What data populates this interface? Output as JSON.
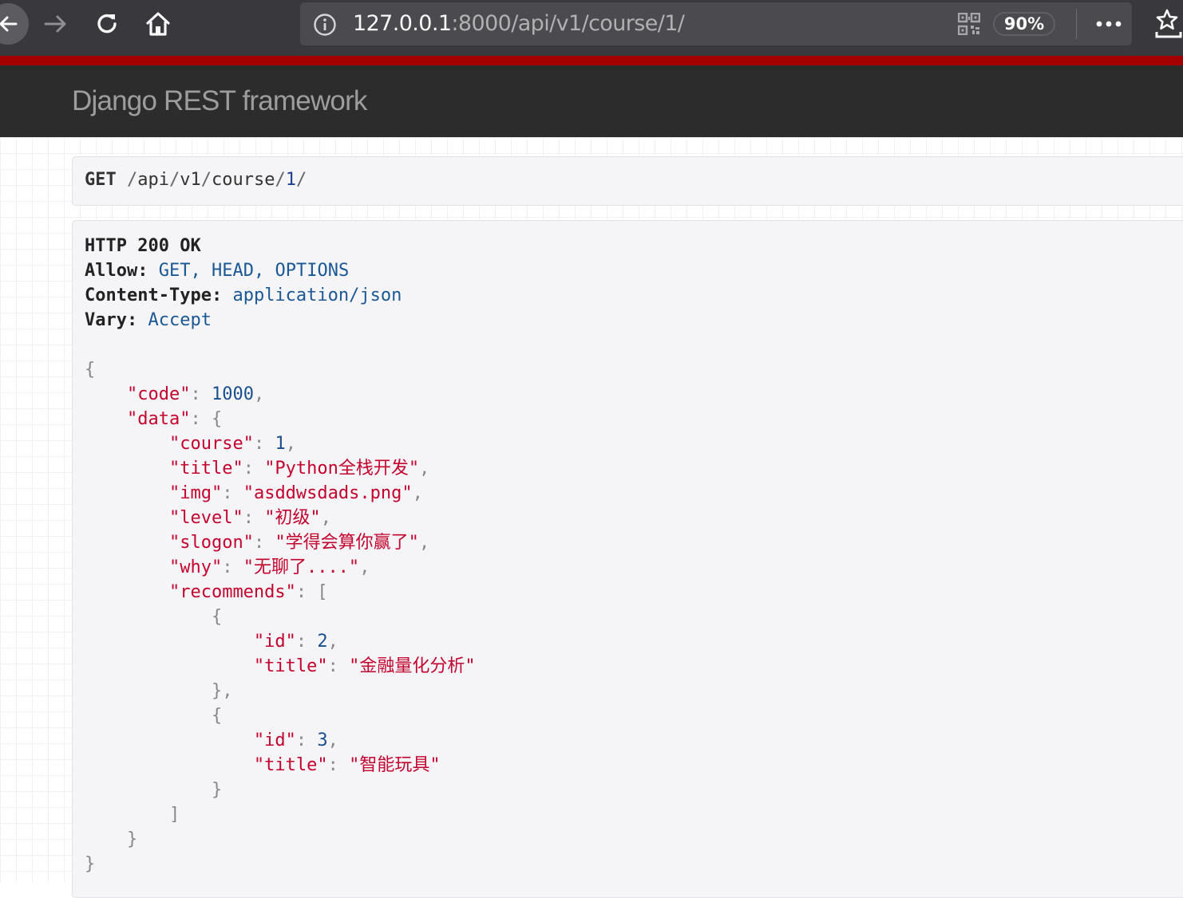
{
  "browser": {
    "url_host": "127.0.0.1",
    "url_rest": ":8000/api/v1/course/1/",
    "zoom": "90%"
  },
  "navbar": {
    "brand": "Django REST framework"
  },
  "request": {
    "method": "GET",
    "path_segments": [
      "api",
      "v1",
      "course",
      "1"
    ]
  },
  "response": {
    "status_line": "HTTP 200 OK",
    "headers": [
      {
        "name": "Allow",
        "values": [
          "GET",
          "HEAD",
          "OPTIONS"
        ]
      },
      {
        "name": "Content-Type",
        "values": [
          "application/json"
        ]
      },
      {
        "name": "Vary",
        "values": [
          "Accept"
        ]
      }
    ],
    "body": {
      "code_key": "\"code\"",
      "code_val": "1000",
      "data_key": "\"data\"",
      "course_key": "\"course\"",
      "course_val": "1",
      "title_key": "\"title\"",
      "title_val": "\"Python全栈开发\"",
      "img_key": "\"img\"",
      "img_val": "\"asddwsdads.png\"",
      "level_key": "\"level\"",
      "level_val": "\"初级\"",
      "slogon_key": "\"slogon\"",
      "slogon_val": "\"学得会算你赢了\"",
      "why_key": "\"why\"",
      "why_val": "\"无聊了....\"",
      "recommends_key": "\"recommends\"",
      "recommends": [
        {
          "id_key": "\"id\"",
          "id_val": "2",
          "title_key": "\"title\"",
          "title_val": "\"金融量化分析\""
        },
        {
          "id_key": "\"id\"",
          "id_val": "3",
          "title_key": "\"title\"",
          "title_val": "\"智能玩具\""
        }
      ]
    }
  }
}
